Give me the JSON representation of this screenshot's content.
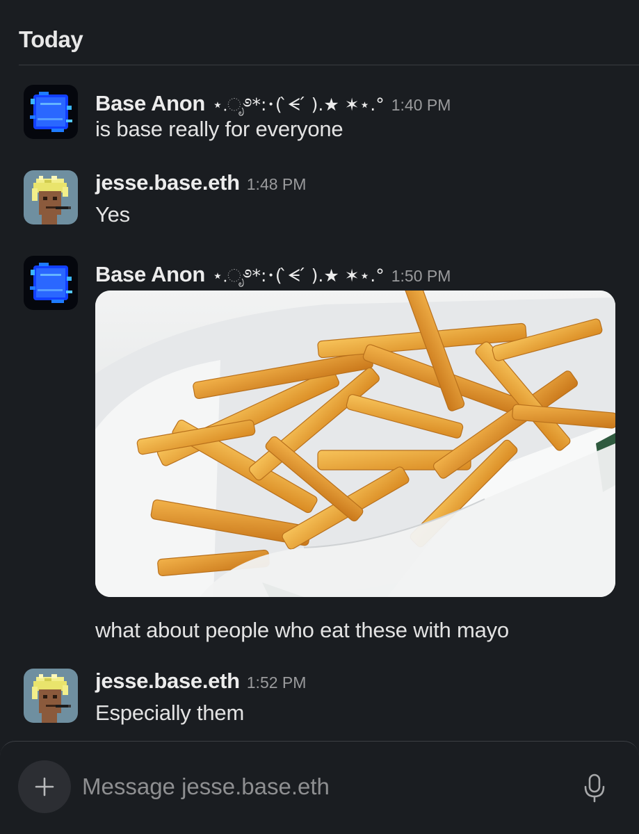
{
  "day_header": "Today",
  "messages": [
    {
      "sender": "Base Anon",
      "decoration": "⋆.ೃ࿔*:･( ̀ᗕ ́ ).★ ✶⋆.°",
      "time": "1:40 PM",
      "text": "is base really for everyone",
      "avatar": "glitch-blue-square"
    },
    {
      "sender": "jesse.base.eth",
      "time": "1:48 PM",
      "text": "Yes",
      "avatar": "pixel-punk"
    },
    {
      "sender": "Base Anon",
      "decoration": "⋆.ೃ࿔*:･( ̀ᗕ ́ ).★ ✶⋆.°",
      "time": "1:50 PM",
      "attachment": "photo-french-fries",
      "text": "what about people who eat these with mayo",
      "avatar": "glitch-blue-square"
    },
    {
      "sender": "jesse.base.eth",
      "time": "1:52 PM",
      "text": "Especially them",
      "avatar": "pixel-punk"
    }
  ],
  "composer": {
    "placeholder": "Message jesse.base.eth",
    "add_icon": "plus-icon",
    "mic_icon": "microphone-icon"
  },
  "colors": {
    "background": "#1a1d21",
    "text": "#e3e3e3",
    "muted": "#9a9b9d",
    "accent_blue": "#1f5bff"
  }
}
